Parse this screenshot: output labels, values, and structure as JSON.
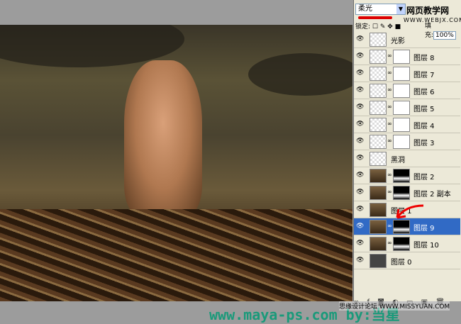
{
  "panel": {
    "blend_mode": "柔光",
    "lock_label": "锁定:",
    "fill_label": "填充:",
    "fill_value": "100%"
  },
  "watermark": {
    "site1": "网页教学网",
    "site2": "WWW.WEBJX.COM",
    "footer": "www.maya-ps.com by:当星",
    "footer2": "思缘设计论坛 WWW.MISSYUAN.COM"
  },
  "layers": [
    {
      "name": "光影",
      "thumb": "transparent",
      "mask": false
    },
    {
      "name": "图层 8",
      "thumb": "transparent",
      "mask": true
    },
    {
      "name": "图层 7",
      "thumb": "transparent",
      "mask": true
    },
    {
      "name": "图层 6",
      "thumb": "transparent",
      "mask": true
    },
    {
      "name": "图层 5",
      "thumb": "transparent",
      "mask": true
    },
    {
      "name": "图层 4",
      "thumb": "transparent",
      "mask": true
    },
    {
      "name": "图层 3",
      "thumb": "transparent",
      "mask": true
    },
    {
      "name": "黑洞",
      "thumb": "transparent",
      "mask": false
    },
    {
      "name": "图层 2",
      "thumb": "image",
      "mask": true
    },
    {
      "name": "图层 2 副本",
      "thumb": "image",
      "mask": true
    },
    {
      "name": "图层 1",
      "thumb": "image",
      "mask": false
    },
    {
      "name": "图层 9",
      "thumb": "image",
      "mask": true,
      "selected": true
    },
    {
      "name": "图层 10",
      "thumb": "image",
      "mask": true
    },
    {
      "name": "图层 0",
      "thumb": "dark",
      "mask": false
    }
  ]
}
